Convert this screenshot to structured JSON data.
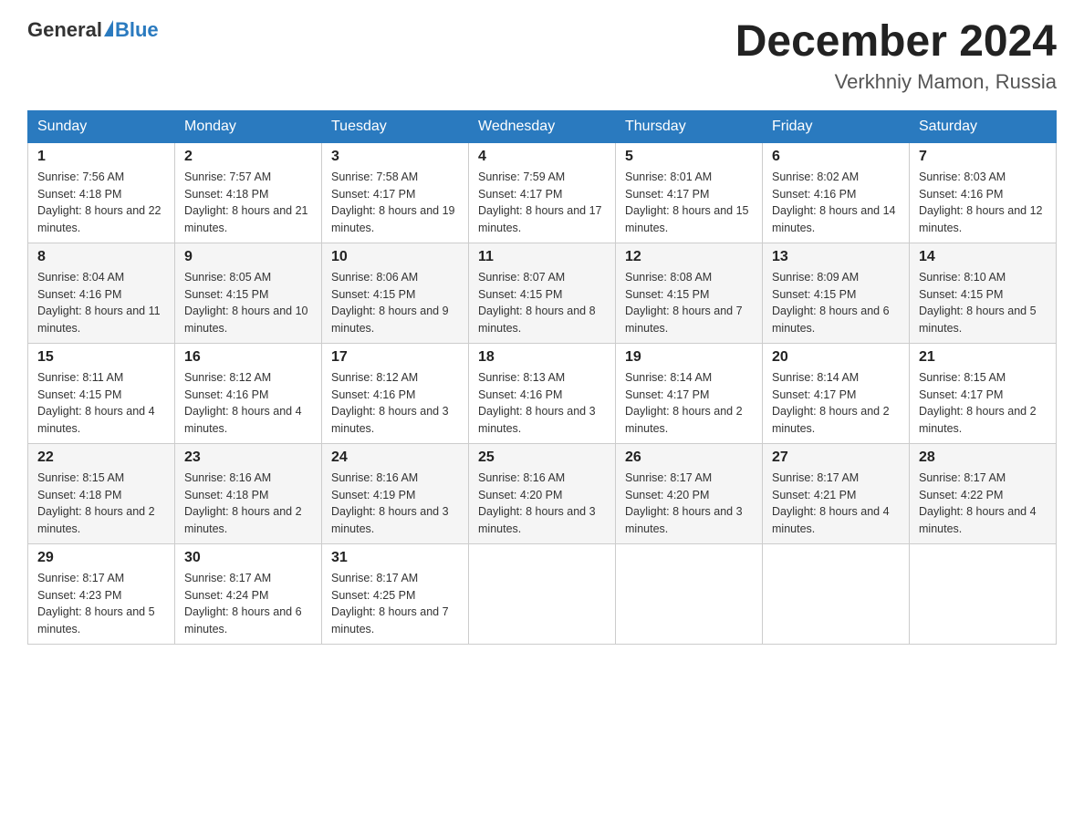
{
  "logo": {
    "general": "General",
    "blue": "Blue",
    "subtitle": "Blue"
  },
  "header": {
    "title": "December 2024",
    "location": "Verkhniy Mamon, Russia"
  },
  "days_of_week": [
    "Sunday",
    "Monday",
    "Tuesday",
    "Wednesday",
    "Thursday",
    "Friday",
    "Saturday"
  ],
  "weeks": [
    [
      {
        "day": "1",
        "sunrise": "7:56 AM",
        "sunset": "4:18 PM",
        "daylight": "8 hours and 22 minutes."
      },
      {
        "day": "2",
        "sunrise": "7:57 AM",
        "sunset": "4:18 PM",
        "daylight": "8 hours and 21 minutes."
      },
      {
        "day": "3",
        "sunrise": "7:58 AM",
        "sunset": "4:17 PM",
        "daylight": "8 hours and 19 minutes."
      },
      {
        "day": "4",
        "sunrise": "7:59 AM",
        "sunset": "4:17 PM",
        "daylight": "8 hours and 17 minutes."
      },
      {
        "day": "5",
        "sunrise": "8:01 AM",
        "sunset": "4:17 PM",
        "daylight": "8 hours and 15 minutes."
      },
      {
        "day": "6",
        "sunrise": "8:02 AM",
        "sunset": "4:16 PM",
        "daylight": "8 hours and 14 minutes."
      },
      {
        "day": "7",
        "sunrise": "8:03 AM",
        "sunset": "4:16 PM",
        "daylight": "8 hours and 12 minutes."
      }
    ],
    [
      {
        "day": "8",
        "sunrise": "8:04 AM",
        "sunset": "4:16 PM",
        "daylight": "8 hours and 11 minutes."
      },
      {
        "day": "9",
        "sunrise": "8:05 AM",
        "sunset": "4:15 PM",
        "daylight": "8 hours and 10 minutes."
      },
      {
        "day": "10",
        "sunrise": "8:06 AM",
        "sunset": "4:15 PM",
        "daylight": "8 hours and 9 minutes."
      },
      {
        "day": "11",
        "sunrise": "8:07 AM",
        "sunset": "4:15 PM",
        "daylight": "8 hours and 8 minutes."
      },
      {
        "day": "12",
        "sunrise": "8:08 AM",
        "sunset": "4:15 PM",
        "daylight": "8 hours and 7 minutes."
      },
      {
        "day": "13",
        "sunrise": "8:09 AM",
        "sunset": "4:15 PM",
        "daylight": "8 hours and 6 minutes."
      },
      {
        "day": "14",
        "sunrise": "8:10 AM",
        "sunset": "4:15 PM",
        "daylight": "8 hours and 5 minutes."
      }
    ],
    [
      {
        "day": "15",
        "sunrise": "8:11 AM",
        "sunset": "4:15 PM",
        "daylight": "8 hours and 4 minutes."
      },
      {
        "day": "16",
        "sunrise": "8:12 AM",
        "sunset": "4:16 PM",
        "daylight": "8 hours and 4 minutes."
      },
      {
        "day": "17",
        "sunrise": "8:12 AM",
        "sunset": "4:16 PM",
        "daylight": "8 hours and 3 minutes."
      },
      {
        "day": "18",
        "sunrise": "8:13 AM",
        "sunset": "4:16 PM",
        "daylight": "8 hours and 3 minutes."
      },
      {
        "day": "19",
        "sunrise": "8:14 AM",
        "sunset": "4:17 PM",
        "daylight": "8 hours and 2 minutes."
      },
      {
        "day": "20",
        "sunrise": "8:14 AM",
        "sunset": "4:17 PM",
        "daylight": "8 hours and 2 minutes."
      },
      {
        "day": "21",
        "sunrise": "8:15 AM",
        "sunset": "4:17 PM",
        "daylight": "8 hours and 2 minutes."
      }
    ],
    [
      {
        "day": "22",
        "sunrise": "8:15 AM",
        "sunset": "4:18 PM",
        "daylight": "8 hours and 2 minutes."
      },
      {
        "day": "23",
        "sunrise": "8:16 AM",
        "sunset": "4:18 PM",
        "daylight": "8 hours and 2 minutes."
      },
      {
        "day": "24",
        "sunrise": "8:16 AM",
        "sunset": "4:19 PM",
        "daylight": "8 hours and 3 minutes."
      },
      {
        "day": "25",
        "sunrise": "8:16 AM",
        "sunset": "4:20 PM",
        "daylight": "8 hours and 3 minutes."
      },
      {
        "day": "26",
        "sunrise": "8:17 AM",
        "sunset": "4:20 PM",
        "daylight": "8 hours and 3 minutes."
      },
      {
        "day": "27",
        "sunrise": "8:17 AM",
        "sunset": "4:21 PM",
        "daylight": "8 hours and 4 minutes."
      },
      {
        "day": "28",
        "sunrise": "8:17 AM",
        "sunset": "4:22 PM",
        "daylight": "8 hours and 4 minutes."
      }
    ],
    [
      {
        "day": "29",
        "sunrise": "8:17 AM",
        "sunset": "4:23 PM",
        "daylight": "8 hours and 5 minutes."
      },
      {
        "day": "30",
        "sunrise": "8:17 AM",
        "sunset": "4:24 PM",
        "daylight": "8 hours and 6 minutes."
      },
      {
        "day": "31",
        "sunrise": "8:17 AM",
        "sunset": "4:25 PM",
        "daylight": "8 hours and 7 minutes."
      },
      null,
      null,
      null,
      null
    ]
  ]
}
